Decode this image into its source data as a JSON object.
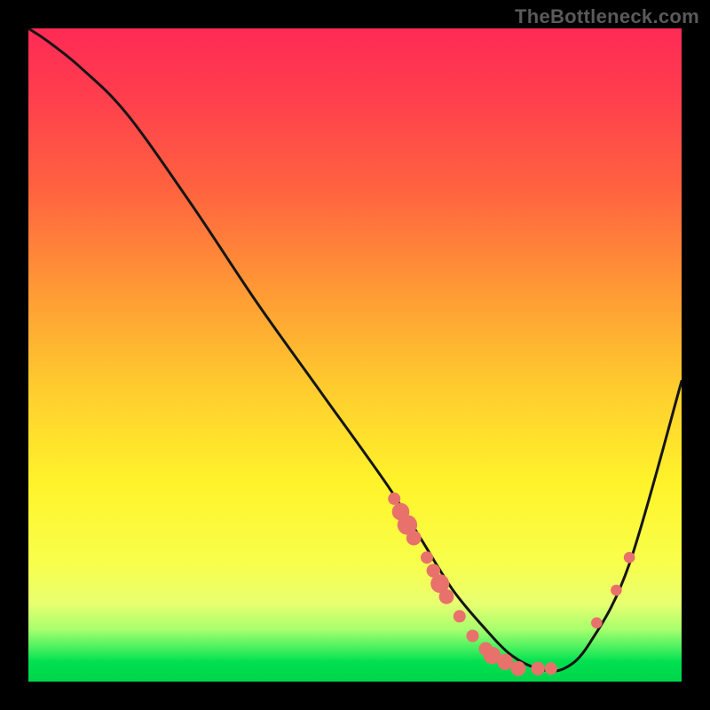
{
  "watermark": "TheBottleneck.com",
  "colors": {
    "page_bg": "#000000",
    "watermark_text": "#5a5a5a",
    "curve_stroke": "#151515",
    "dot_fill": "#e8716b",
    "gradient_top": "#ff2a55",
    "gradient_bottom": "#00d54a"
  },
  "chart_data": {
    "type": "line",
    "title": "",
    "xlabel": "",
    "ylabel": "",
    "xlim": [
      0,
      100
    ],
    "ylim": [
      0,
      100
    ],
    "grid": false,
    "legend": false,
    "series": [
      {
        "name": "bottleneck-curve",
        "x": [
          0,
          3,
          8,
          15,
          25,
          35,
          45,
          55,
          60,
          65,
          70,
          74,
          78,
          82,
          86,
          92,
          100
        ],
        "y": [
          100,
          98,
          94,
          87,
          73,
          58,
          44,
          30,
          22,
          14,
          8,
          4,
          2,
          2,
          6,
          18,
          46
        ]
      }
    ],
    "points": [
      {
        "x": 56,
        "y": 28,
        "r": 1.0
      },
      {
        "x": 57,
        "y": 26,
        "r": 1.4
      },
      {
        "x": 58,
        "y": 24,
        "r": 1.6
      },
      {
        "x": 59,
        "y": 22,
        "r": 1.2
      },
      {
        "x": 61,
        "y": 19,
        "r": 1.0
      },
      {
        "x": 62,
        "y": 17,
        "r": 1.1
      },
      {
        "x": 63,
        "y": 15,
        "r": 1.5
      },
      {
        "x": 64,
        "y": 13,
        "r": 1.2
      },
      {
        "x": 66,
        "y": 10,
        "r": 1.0
      },
      {
        "x": 68,
        "y": 7,
        "r": 1.0
      },
      {
        "x": 70,
        "y": 5,
        "r": 1.1
      },
      {
        "x": 71,
        "y": 4,
        "r": 1.4
      },
      {
        "x": 73,
        "y": 3,
        "r": 1.3
      },
      {
        "x": 75,
        "y": 2,
        "r": 1.2
      },
      {
        "x": 78,
        "y": 2,
        "r": 1.1
      },
      {
        "x": 80,
        "y": 2,
        "r": 1.0
      },
      {
        "x": 87,
        "y": 9,
        "r": 0.9
      },
      {
        "x": 90,
        "y": 14,
        "r": 0.9
      },
      {
        "x": 92,
        "y": 19,
        "r": 0.9
      }
    ]
  }
}
